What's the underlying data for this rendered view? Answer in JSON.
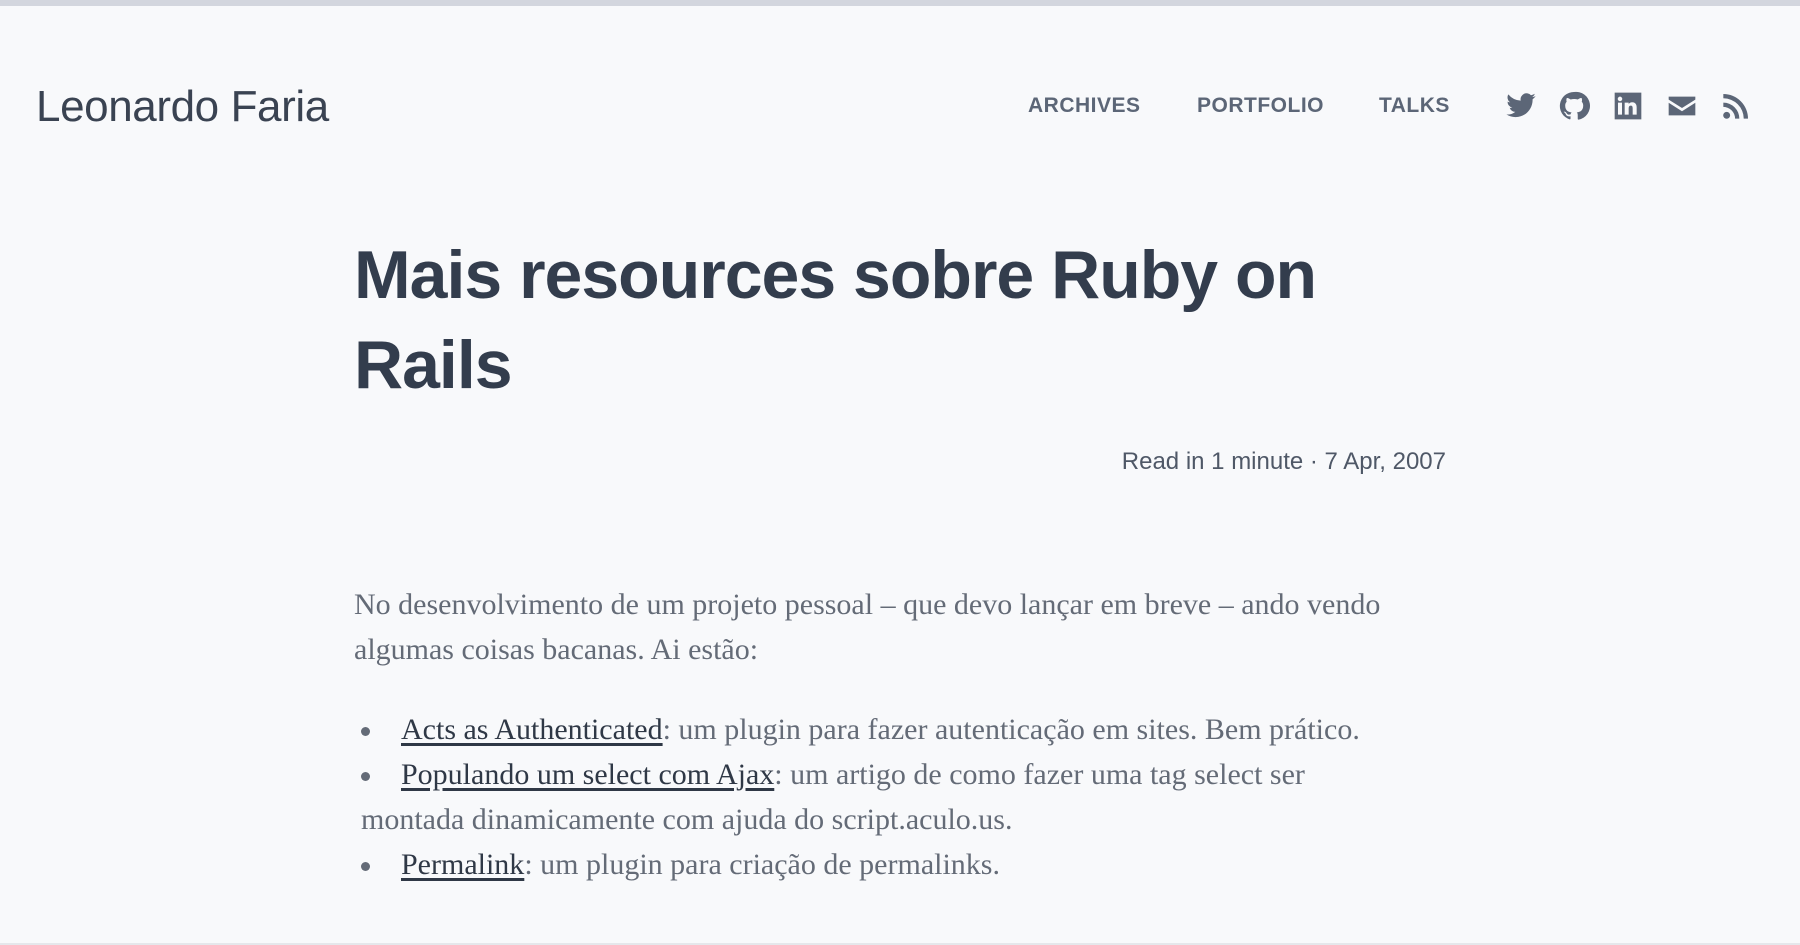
{
  "site": {
    "title": "Leonardo Faria"
  },
  "nav": {
    "items": [
      "ARCHIVES",
      "PORTFOLIO",
      "TALKS"
    ]
  },
  "social_icons": [
    "twitter-icon",
    "github-icon",
    "linkedin-icon",
    "mail-icon",
    "rss-icon"
  ],
  "post": {
    "title": "Mais resources sobre Ruby on Rails",
    "meta": "Read in 1 minute · 7 Apr, 2007",
    "intro": "No desenvolvimento de um projeto pessoal – que devo lançar em breve – ando vendo algumas coisas bacanas. Ai estão:",
    "list": [
      {
        "link": "Acts as Authenticated",
        "text": ": um plugin para fazer autenticação em sites. Bem prático."
      },
      {
        "link": "Populando um select com Ajax",
        "text": ": um artigo de como fazer uma tag select ser montada dinamicamente com ajuda do script.aculo.us."
      },
      {
        "link": "Permalink",
        "text": ": um plugin para criação de permalinks."
      }
    ]
  },
  "colors": {
    "background": "#f8f9fb",
    "text": "#333d4d",
    "muted": "#646b77"
  }
}
